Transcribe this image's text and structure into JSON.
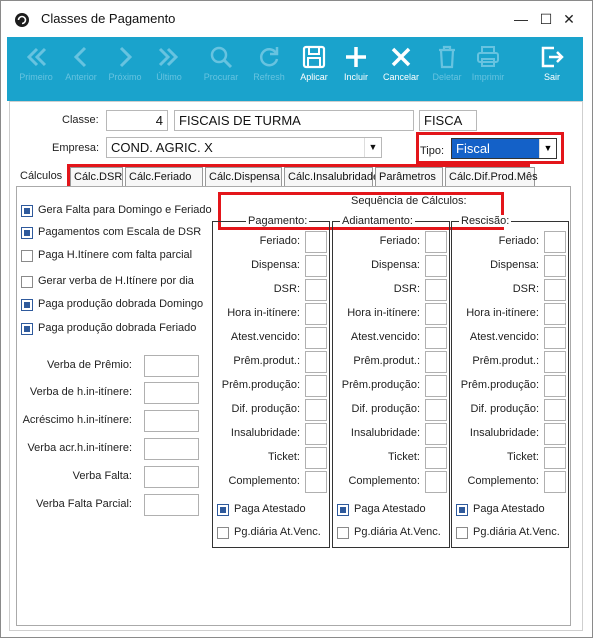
{
  "window": {
    "title": "Classes de Pagamento"
  },
  "toolbar": [
    {
      "id": "primeiro",
      "label": "Primeiro",
      "icon": "double-chevron-left-icon",
      "enabled": false
    },
    {
      "id": "anterior",
      "label": "Anterior",
      "icon": "chevron-left-icon",
      "enabled": false
    },
    {
      "id": "proximo",
      "label": "Próximo",
      "icon": "chevron-right-icon",
      "enabled": false
    },
    {
      "id": "ultimo",
      "label": "Último",
      "icon": "double-chevron-right-icon",
      "enabled": false
    },
    {
      "id": "procurar",
      "label": "Procurar",
      "icon": "search-icon",
      "enabled": false
    },
    {
      "id": "refresh",
      "label": "Refresh",
      "icon": "refresh-icon",
      "enabled": false
    },
    {
      "id": "aplicar",
      "label": "Aplicar",
      "icon": "save-icon",
      "enabled": true
    },
    {
      "id": "incluir",
      "label": "Incluir",
      "icon": "plus-icon",
      "enabled": true
    },
    {
      "id": "cancelar",
      "label": "Cancelar",
      "icon": "x-icon",
      "enabled": true
    },
    {
      "id": "deletar",
      "label": "Deletar",
      "icon": "trash-icon",
      "enabled": false
    },
    {
      "id": "imprimir",
      "label": "Imprimir",
      "icon": "printer-icon",
      "enabled": false
    },
    {
      "id": "sair",
      "label": "Sair",
      "icon": "exit-icon",
      "enabled": true
    }
  ],
  "form": {
    "classe_label": "Classe:",
    "classe_code": "4",
    "classe_name": "FISCAIS DE TURMA",
    "classe_abbrev": "FISCA",
    "empresa_label": "Empresa:",
    "empresa_value": "COND. AGRIC. X",
    "tipo_label": "Tipo:",
    "tipo_value": "Fiscal"
  },
  "tabs": {
    "first": "Cálculos",
    "items": [
      "Cálc.DSR",
      "Cálc.Feriado",
      "Cálc.Dispensa",
      "Cálc.Insalubridade",
      "Parâmetros",
      "Cálc.Dif.Prod.Mês"
    ]
  },
  "checks": [
    {
      "label": "Gera Falta para Domingo e Feriado",
      "checked": true
    },
    {
      "label": "Pagamentos com Escala de DSR",
      "checked": true
    },
    {
      "label": "Paga H.Itínere com falta parcial",
      "checked": false
    },
    {
      "label": "Gerar verba de H.Itínere por dia",
      "checked": false
    },
    {
      "label": "Paga produção dobrada Domingo",
      "checked": true
    },
    {
      "label": "Paga produção dobrada Feriado",
      "checked": true
    }
  ],
  "verbas": [
    "Verba de Prêmio:",
    "Verba de h.in-itínere:",
    "Acréscimo h.in-itínere:",
    "Verba acr.h.in-itínere:",
    "Verba Falta:",
    "Verba Falta Parcial:"
  ],
  "sequencia": {
    "title": "Sequência de Cálculos:",
    "columns": [
      "Pagamento:",
      "Adiantamento:",
      "Rescisão:"
    ],
    "rows": [
      "Feriado:",
      "Dispensa:",
      "DSR:",
      "Hora in-itínere:",
      "Atest.vencido:",
      "Prêm.produt.:",
      "Prêm.produção:",
      "Dif. produção:",
      "Insalubridade:",
      "Ticket:",
      "Complemento:"
    ],
    "paga_atestado": "Paga Atestado",
    "pg_diaria": "Pg.diária At.Venc."
  }
}
